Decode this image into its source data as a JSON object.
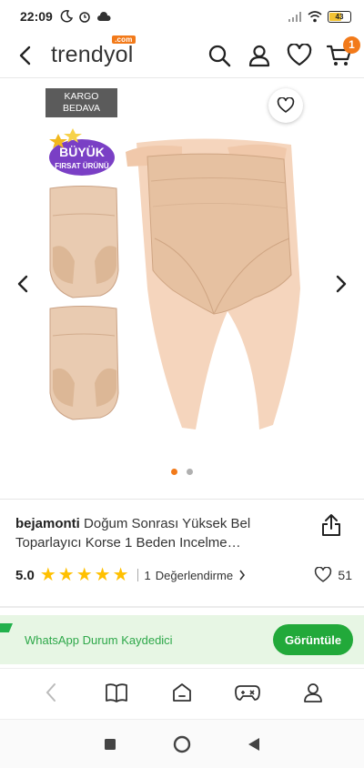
{
  "status_bar": {
    "time": "22:09",
    "battery_level": "43"
  },
  "header": {
    "logo_text": "trendyol",
    "logo_sup": ".com",
    "cart_count": "1",
    "accent_color": "#f27a1a"
  },
  "gallery": {
    "cargo_badge": "KARGO BEDAVA",
    "deal_badge_line1": "BÜYÜK",
    "deal_badge_line2": "FIRSAT ÜRÜNÜ",
    "active_index": 1,
    "image_count": 2
  },
  "product": {
    "brand": "bejamonti",
    "name": "Doğum Sonrası Yüksek Bel Toparlayıcı Korse 1 Beden Incelme…"
  },
  "rating": {
    "value": "5.0",
    "stars": 5,
    "review_count": "1",
    "review_label": "Değerlendirme",
    "likes": "51"
  },
  "banner": {
    "text": "WhatsApp Durum Kaydedici",
    "button_label": "Görüntüle",
    "color": "#22a93a"
  }
}
